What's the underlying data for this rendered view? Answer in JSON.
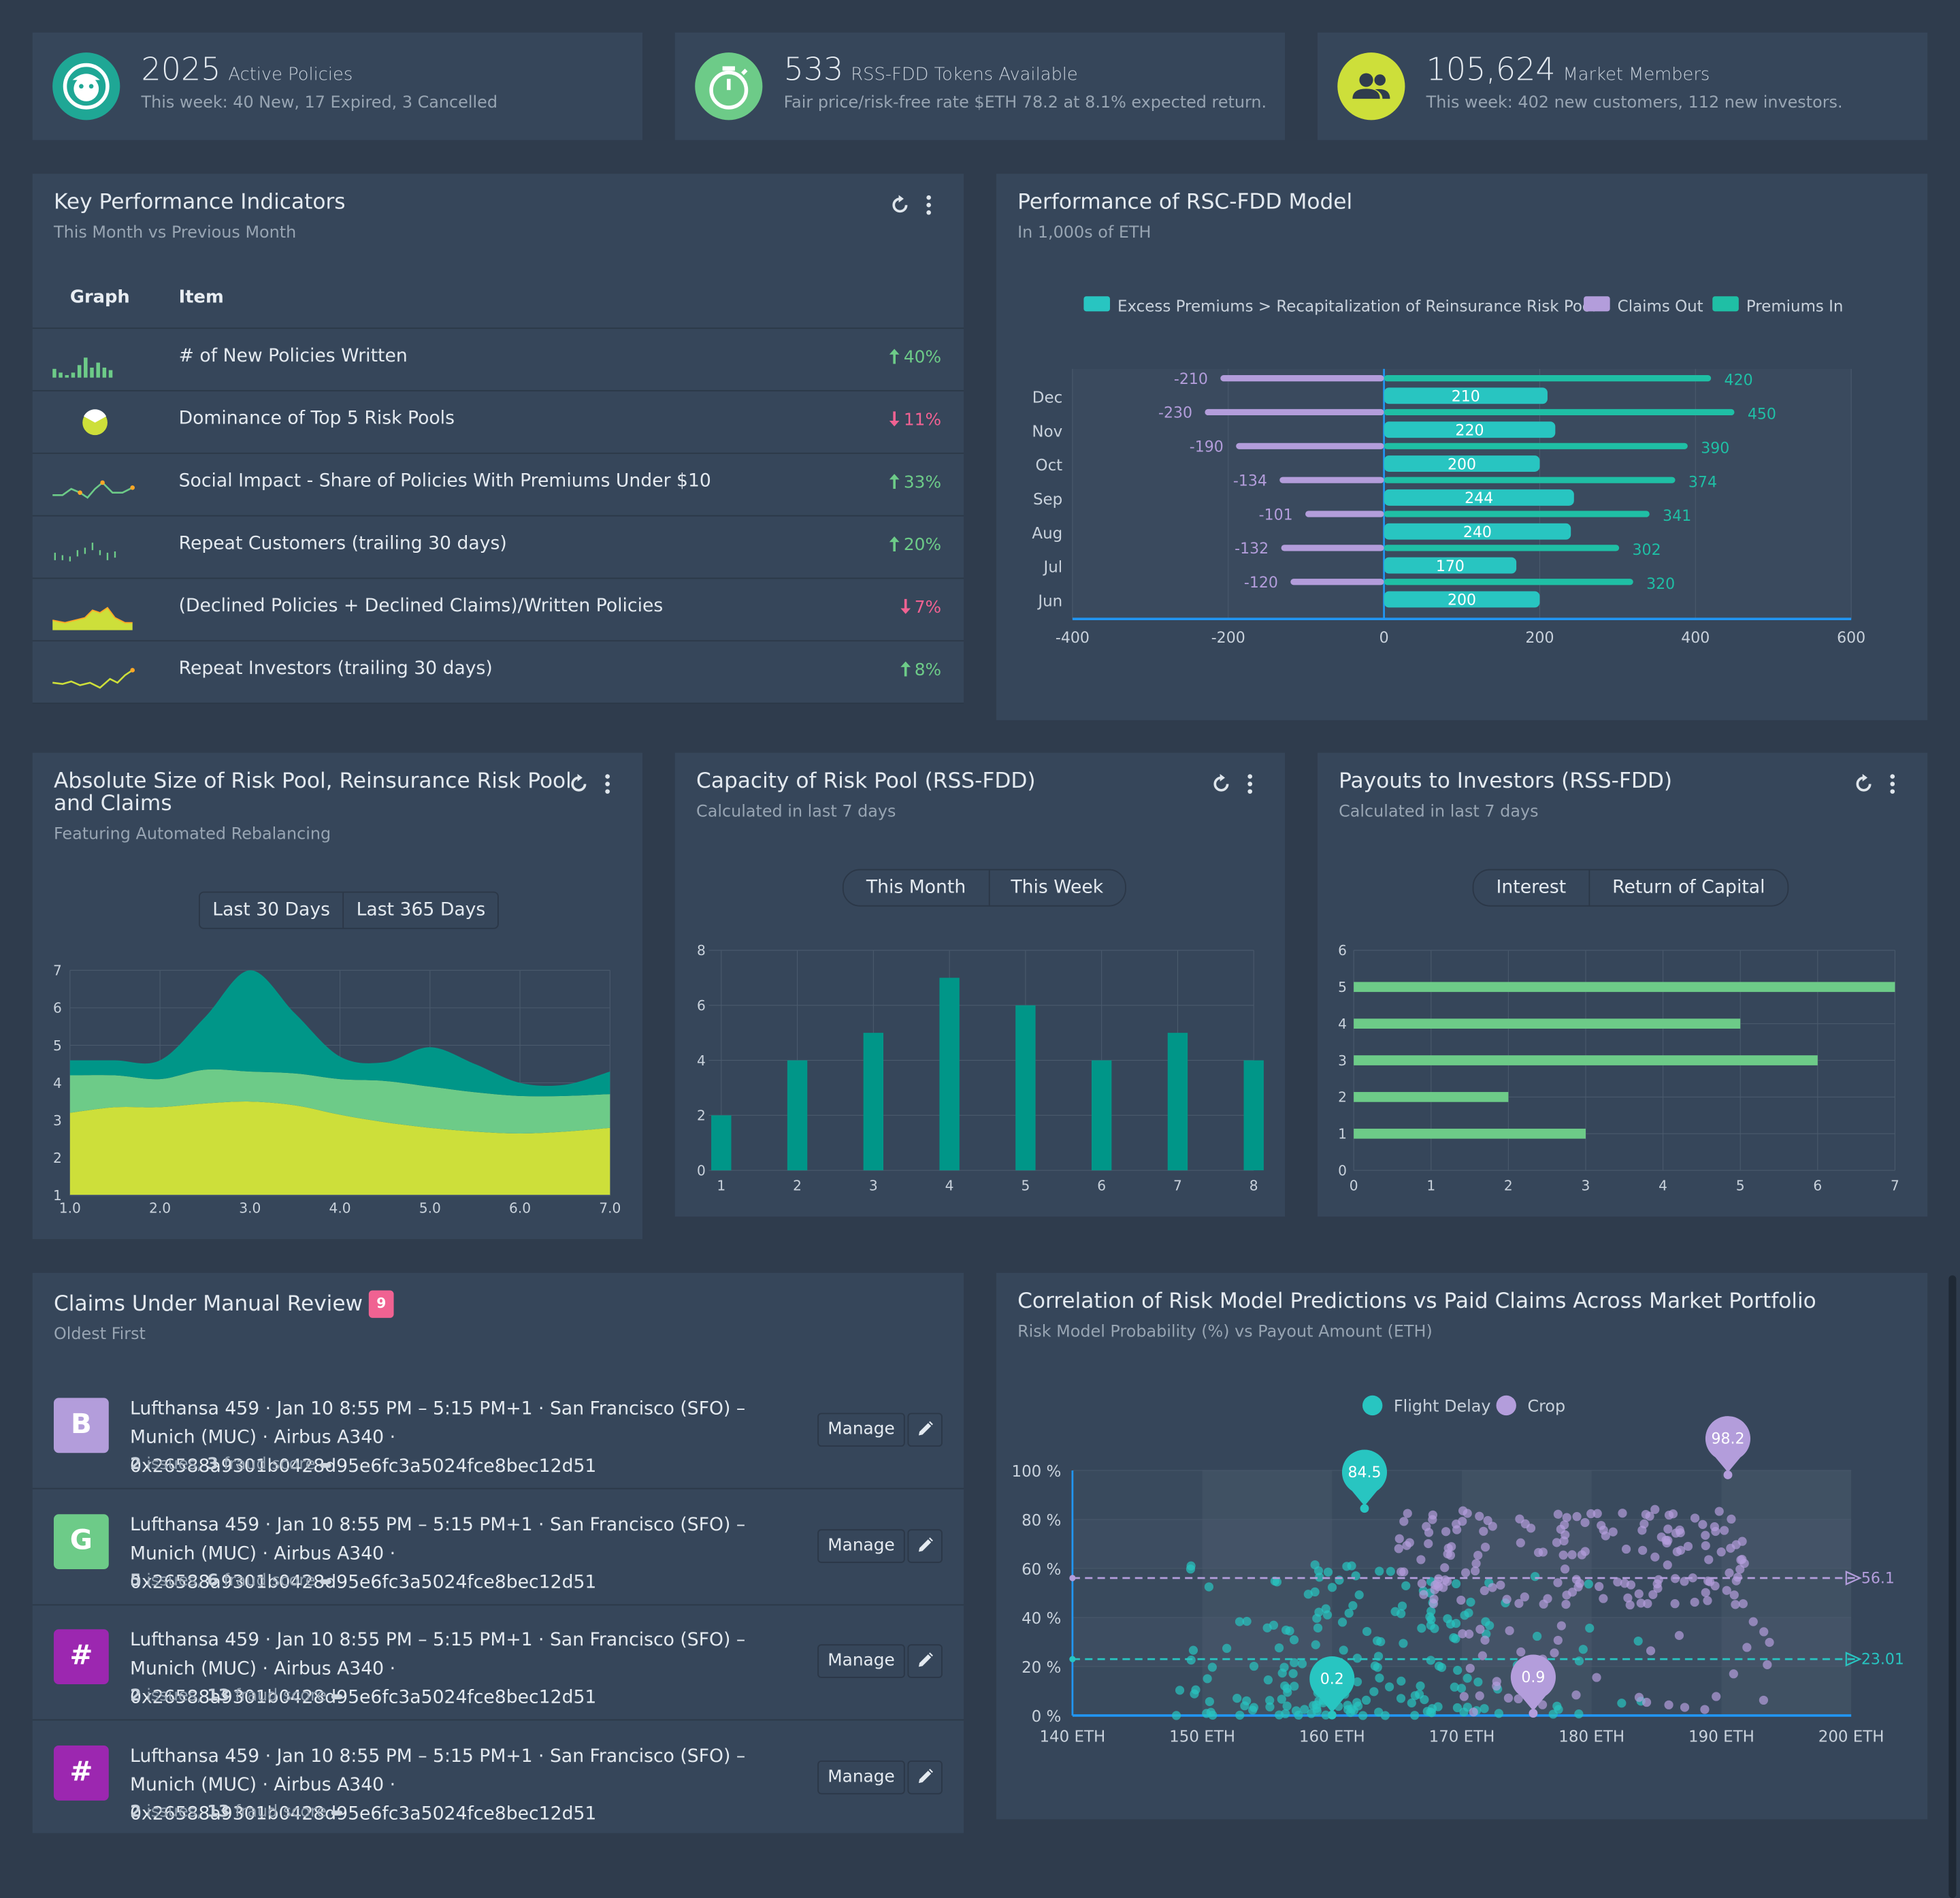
{
  "stats": [
    {
      "value": "2025",
      "unit": "Active Policies",
      "sub": "This week: 40 New, 17 Expired, 3 Cancelled",
      "icon": "face-icon",
      "color": "#1fa795"
    },
    {
      "value": "533",
      "unit": "RSS-FDD Tokens Available",
      "sub": "Fair price/risk-free rate $ETH 78.2 at 8.1% expected return.",
      "icon": "stopwatch-icon",
      "color": "#6dcb88"
    },
    {
      "value": "105,624",
      "unit": "Market Members",
      "sub": "This week: 402 new customers, 112 new investors.",
      "icon": "people-icon",
      "color": "#cddf3a"
    }
  ],
  "kpi": {
    "title": "Key Performance Indicators",
    "subtitle": "This Month vs Previous Month",
    "col_graph": "Graph",
    "col_item": "Item",
    "rows": [
      {
        "item": "# of New Policies Written",
        "trend": "40%",
        "direction": "up"
      },
      {
        "item": "Dominance of Top 5 Risk Pools",
        "trend": "11%",
        "direction": "down"
      },
      {
        "item": "Social Impact - Share of Policies With Premiums Under $10",
        "trend": "33%",
        "direction": "up"
      },
      {
        "item": "Repeat Customers (trailing 30 days)",
        "trend": "20%",
        "direction": "up"
      },
      {
        "item": "(Declined Policies + Declined Claims)/Written Policies",
        "trend": "7%",
        "direction": "down"
      },
      {
        "item": "Repeat Investors (trailing 30 days)",
        "trend": "8%",
        "direction": "up"
      }
    ]
  },
  "perf": {
    "title": "Performance of RSC-FDD Model",
    "subtitle": "In 1,000s of ETH"
  },
  "size_card": {
    "title": "Absolute Size of Risk Pool, Reinsurance Risk Pool and Claims",
    "subtitle": "Featuring Automated Rebalancing",
    "tabs": [
      "Last 30 Days",
      "Last 365 Days"
    ]
  },
  "capacity_card": {
    "title": "Capacity of Risk Pool (RSS-FDD)",
    "subtitle": "Calculated in last 7 days",
    "tabs": [
      "This Month",
      "This Week"
    ]
  },
  "payouts_card": {
    "title": "Payouts to Investors (RSS-FDD)",
    "subtitle": "Calculated in last 7 days",
    "tabs": [
      "Interest",
      "Return of Capital"
    ]
  },
  "claims": {
    "title": "Claims Under Manual Review",
    "badge": "9",
    "subtitle": "Oldest First",
    "manage_label": "Manage",
    "items": [
      {
        "avatar": "B",
        "color": "#b39ddb",
        "text": "Lufthansa 459 · Jan 10 8:55 PM – 5:15 PM+1 · San Francisco (SFO) – Munich (MUC) · Airbus A340 · 0x26588a9301b0428d95e6fc3a5024fce8bec12d51",
        "issues": "2",
        "issues_label": "issues,",
        "fraud": "3",
        "fraud_label": "fraud score"
      },
      {
        "avatar": "G",
        "color": "#6dcb88",
        "text": "Lufthansa 459 · Jan 10 8:55 PM – 5:15 PM+1 · San Francisco (SFO) – Munich (MUC) · Airbus A340 · 0x26588a9301b0428d95e6fc3a5024fce8bec12d51",
        "issues": "5",
        "issues_label": "issues,",
        "fraud": "6",
        "fraud_label": "fraud score"
      },
      {
        "avatar": "#",
        "color": "#9c27b0",
        "text": "Lufthansa 459 · Jan 10 8:55 PM – 5:15 PM+1 · San Francisco (SFO) – Munich (MUC) · Airbus A340 · 0x26588a9301b0428d95e6fc3a5024fce8bec12d51",
        "issues": "2",
        "issues_label": "issues,",
        "fraud": "13",
        "fraud_label": "fraud score"
      },
      {
        "avatar": "#",
        "color": "#9c27b0",
        "text": "Lufthansa 459 · Jan 10 8:55 PM – 5:15 PM+1 · San Francisco (SFO) – Munich (MUC) · Airbus A340 · 0x26588a9301b0428d95e6fc3a5024fce8bec12d51",
        "issues": "2",
        "issues_label": "issues,",
        "fraud": "13",
        "fraud_label": "fraud score"
      }
    ]
  },
  "corr": {
    "title": "Correlation of Risk Model Predictions vs Paid Claims Across Market Portfolio",
    "subtitle": "Risk Model Probability (%) vs Payout Amount (ETH)"
  },
  "chart_data": [
    {
      "id": "perf",
      "type": "bar",
      "orientation": "horizontal",
      "categories": [
        "Dec",
        "Nov",
        "Oct",
        "Sep",
        "Aug",
        "Jul",
        "Jun"
      ],
      "series": [
        {
          "name": "Excess Premiums > Recapitalization of Reinsurance Risk Pool",
          "values": [
            210,
            220,
            200,
            244,
            240,
            170,
            200
          ],
          "color": "#28c5c1"
        },
        {
          "name": "Claims Out",
          "values": [
            -210,
            -230,
            -190,
            -134,
            -101,
            -132,
            -120
          ],
          "color": "#b39ddb"
        },
        {
          "name": "Premiums In",
          "values": [
            420,
            450,
            390,
            374,
            341,
            302,
            320
          ],
          "color": "#1fbfa5"
        }
      ],
      "xlim": [
        -400,
        600
      ],
      "xticks": [
        -400,
        -200,
        0,
        200,
        400,
        600
      ],
      "legend": "top"
    },
    {
      "id": "size",
      "type": "area",
      "stacked": true,
      "x": [
        1,
        1.5,
        2,
        2.5,
        3,
        3.5,
        4,
        4.5,
        5,
        5.5,
        6,
        6.5,
        7
      ],
      "series": [
        {
          "values": [
            2.2,
            2.35,
            2.35,
            2.45,
            2.5,
            2.4,
            2.15,
            1.95,
            1.8,
            1.7,
            1.65,
            1.7,
            1.8
          ],
          "color": "#cddf3a"
        },
        {
          "values": [
            1.0,
            0.85,
            0.75,
            0.9,
            0.8,
            0.85,
            0.95,
            1.1,
            1.1,
            1.05,
            1.0,
            0.95,
            0.9
          ],
          "color": "#6dcb88"
        },
        {
          "values": [
            0.4,
            0.4,
            0.5,
            1.4,
            2.7,
            1.6,
            0.6,
            0.5,
            1.05,
            0.75,
            0.35,
            0.3,
            0.6
          ],
          "color": "#009688"
        }
      ],
      "xticks": [
        "1.0",
        "2.0",
        "3.0",
        "4.0",
        "5.0",
        "6.0",
        "7.0"
      ],
      "xlim": [
        1,
        7
      ],
      "ylim": [
        1,
        7
      ]
    },
    {
      "id": "capacity",
      "type": "bar",
      "categories": [
        "1",
        "2",
        "3",
        "4",
        "5",
        "6",
        "7",
        "8"
      ],
      "values": [
        2,
        4,
        5,
        7,
        6,
        4,
        5,
        4
      ],
      "color": "#009688",
      "ylim": [
        0,
        8
      ],
      "yticks": [
        0,
        2,
        4,
        6,
        8
      ]
    },
    {
      "id": "payouts",
      "type": "bar",
      "orientation": "horizontal",
      "categories": [
        "5",
        "4",
        "3",
        "2",
        "1"
      ],
      "values": [
        7,
        5,
        6,
        2,
        3
      ],
      "color": "#6dcb88",
      "xlim": [
        0,
        7
      ],
      "ylim": [
        0,
        6
      ],
      "yticks": [
        "0",
        "1",
        "2",
        "3",
        "4",
        "5",
        "6"
      ]
    },
    {
      "id": "corr",
      "type": "scatter",
      "series": [
        {
          "name": "Flight Delay",
          "color": "#28c5c1",
          "mean_line": 23.01,
          "highlights": [
            {
              "x": 162.5,
              "y": 84.5
            },
            {
              "x": 160,
              "y": 0.2
            }
          ]
        },
        {
          "name": "Crop",
          "color": "#b39ddb",
          "mean_line": 56.1,
          "highlights": [
            {
              "x": 190.5,
              "y": 98.2
            },
            {
              "x": 175.5,
              "y": 0.9
            }
          ]
        }
      ],
      "xlim": [
        140,
        200
      ],
      "xticks": [
        "140 ETH",
        "150 ETH",
        "160 ETH",
        "170 ETH",
        "180 ETH",
        "190 ETH",
        "200 ETH"
      ],
      "ylim": [
        0,
        100
      ],
      "yticks": [
        "0 %",
        "20 %",
        "40 %",
        "60 %",
        "80 %",
        "100 %"
      ],
      "legend": "top"
    }
  ]
}
